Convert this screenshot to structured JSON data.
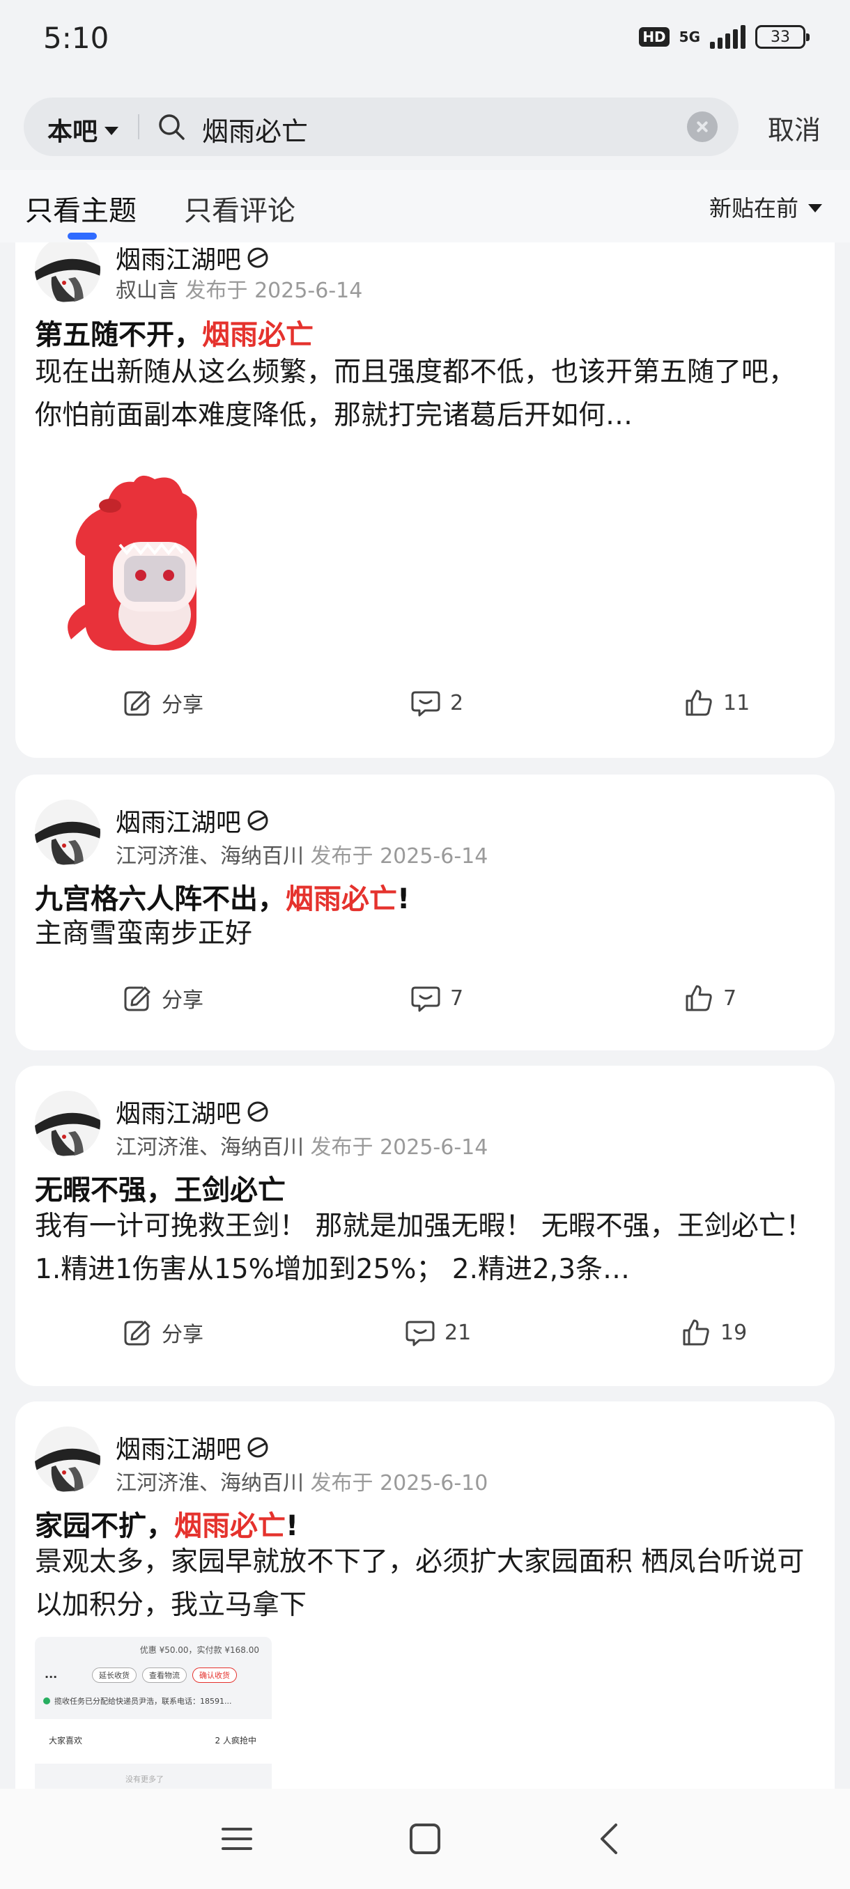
{
  "status": {
    "time": "5:10",
    "hd": "HD",
    "network": "5G",
    "battery": "33"
  },
  "search": {
    "scope": "本吧",
    "query": "烟雨必亡",
    "cancel": "取消"
  },
  "tabs": {
    "topics_only": "只看主题",
    "comments_only": "只看评论",
    "sort": "新贴在前"
  },
  "posts": [
    {
      "forum": "烟雨江湖吧",
      "author": "叔山言",
      "date": "发布于 2025-6-14",
      "title_pre": "第五随不开，",
      "title_hl": "烟雨必亡",
      "title_post": "",
      "body": "现在出新随从这么频繁，而且强度都不低，也该开第五随了吧，你怕前面副本难度降低，那就打完诸葛后开如何…",
      "share": "分享",
      "comments": "2",
      "likes": "11"
    },
    {
      "forum": "烟雨江湖吧",
      "author": "江河济淮、海纳百川",
      "date": "发布于 2025-6-14",
      "title_pre": "九宫格六人阵不出，",
      "title_hl": "烟雨必亡",
      "title_post": "!",
      "body": "主商雪蛮南步正好",
      "share": "分享",
      "comments": "7",
      "likes": "7"
    },
    {
      "forum": "烟雨江湖吧",
      "author": "江河济淮、海纳百川",
      "date": "发布于 2025-6-14",
      "title_pre": "无暇不强，王剑必亡",
      "title_hl": "",
      "title_post": "",
      "body": "我有一计可挽救王剑！ 那就是加强无暇！ 无暇不强，王剑必亡！ 1.精进1伤害从15%增加到25%； 2.精进2,3条…",
      "share": "分享",
      "comments": "21",
      "likes": "19"
    },
    {
      "forum": "烟雨江湖吧",
      "author": "江河济淮、海纳百川",
      "date": "发布于 2025-6-10",
      "title_pre": "家园不扩，",
      "title_hl": "烟雨必亡",
      "title_post": "!",
      "body": "景观太多，家园早就放不下了，必须扩大家园面积 栖凤台听说可以加积分，我立马拿下"
    }
  ],
  "thumbnail": {
    "price": "优惠 ¥50.00，实付款 ¥168.00",
    "btn_extend": "延长收货",
    "btn_logistics": "查看物流",
    "btn_confirm": "确认收货",
    "notice": "揽收任务已分配给快递员尹浩，联系电话：18591...",
    "likes_label": "大家喜欢",
    "grab": "2 人疯抢中",
    "no_more": "没有更多了"
  },
  "colors": {
    "highlight": "#e5322d",
    "accent": "#2f6bff"
  }
}
